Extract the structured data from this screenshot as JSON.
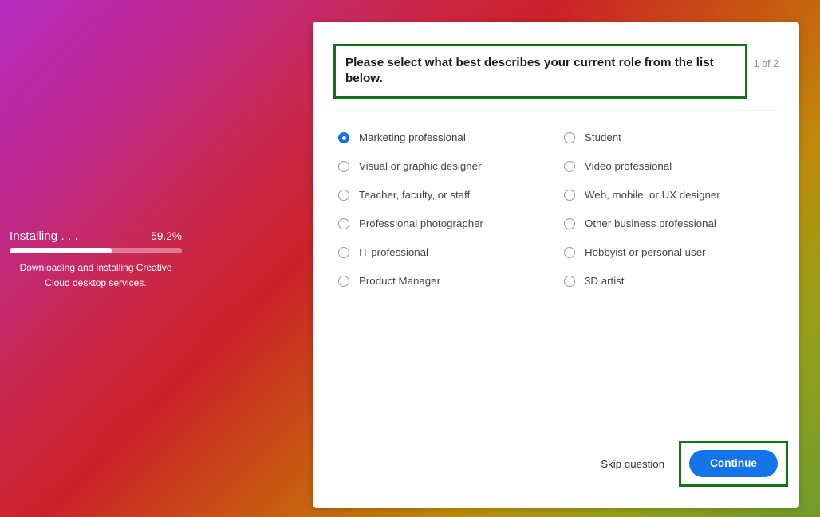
{
  "installer": {
    "status_label": "Installing . . .",
    "percent_label": "59.2%",
    "percent_value": 59.2,
    "description": "Downloading and installing Creative Cloud desktop services.",
    "progress_fill_color": "#ffffff",
    "progress_track_color": "rgba(255,255,255,0.38)"
  },
  "dialog": {
    "question": "Please select what best describes your current role from the list below.",
    "page_indicator": "1 of 2",
    "highlight_color": "#14711a",
    "accent_color": "#1473e6",
    "options_left": [
      {
        "label": "Marketing professional",
        "selected": true
      },
      {
        "label": "Visual or graphic designer",
        "selected": false
      },
      {
        "label": "Teacher, faculty, or staff",
        "selected": false
      },
      {
        "label": "Professional photographer",
        "selected": false
      },
      {
        "label": "IT professional",
        "selected": false
      },
      {
        "label": "Product Manager",
        "selected": false
      }
    ],
    "options_right": [
      {
        "label": "Student",
        "selected": false
      },
      {
        "label": "Video professional",
        "selected": false
      },
      {
        "label": "Web, mobile, or UX designer",
        "selected": false
      },
      {
        "label": "Other business professional",
        "selected": false
      },
      {
        "label": "Hobbyist or personal user",
        "selected": false
      },
      {
        "label": "3D artist",
        "selected": false
      }
    ],
    "footer": {
      "skip_label": "Skip question",
      "continue_label": "Continue"
    }
  },
  "background": {
    "colors": [
      "#b52bbf",
      "#c9284f",
      "#cb2229",
      "#c85a10",
      "#bf8b09",
      "#6f9b2c"
    ]
  }
}
